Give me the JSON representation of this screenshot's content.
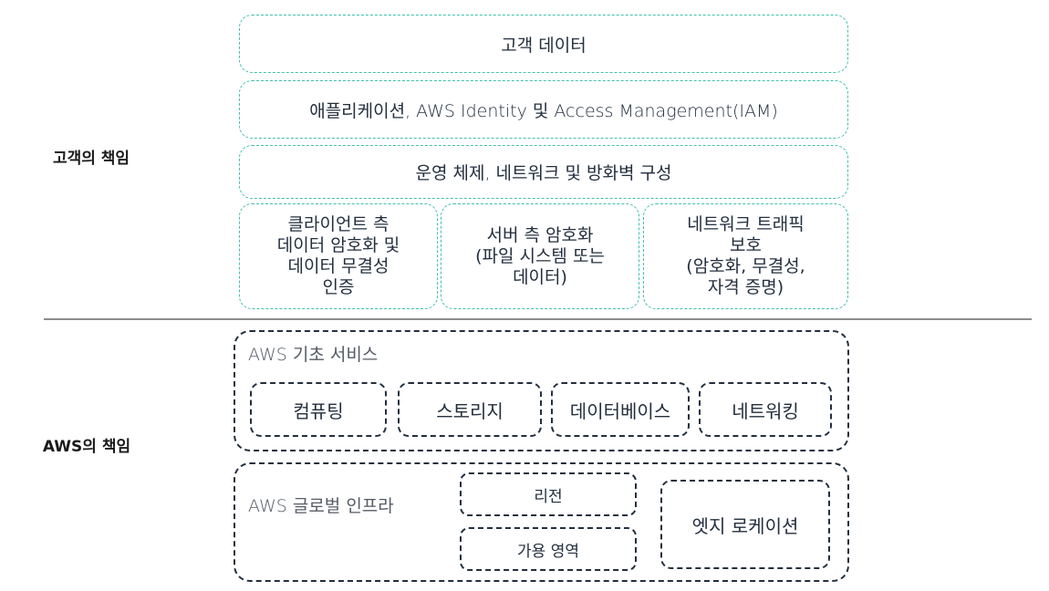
{
  "customer": {
    "label": "고객의 책임",
    "layers": [
      "고객 데이터",
      "애플리케이션, AWS Identity 및 Access Management(IAM)",
      "운영 체제, 네트워크 및 방화벽 구성"
    ],
    "boxes": [
      "클라이언트 측\n데이터 암호화 및\n데이터 무결성\n인증",
      "서버 측 암호화\n(파일 시스템 또는\n데이터)",
      "네트워크 트래픽\n보호\n(암호화, 무결성,\n자격 증명)"
    ]
  },
  "aws": {
    "label": "AWS의 책임",
    "foundation": {
      "title": "AWS 기초 서비스",
      "services": [
        "컴퓨팅",
        "스토리지",
        "데이터베이스",
        "네트워킹"
      ]
    },
    "infra": {
      "title": "AWS 글로벌 인프라",
      "region": "리전",
      "az": "가용 영역",
      "edge": "엣지 로케이션"
    }
  },
  "colors": {
    "customer_border": "#3fbfad",
    "aws_border": "#232f3e",
    "divider": "#8c8c8c"
  }
}
